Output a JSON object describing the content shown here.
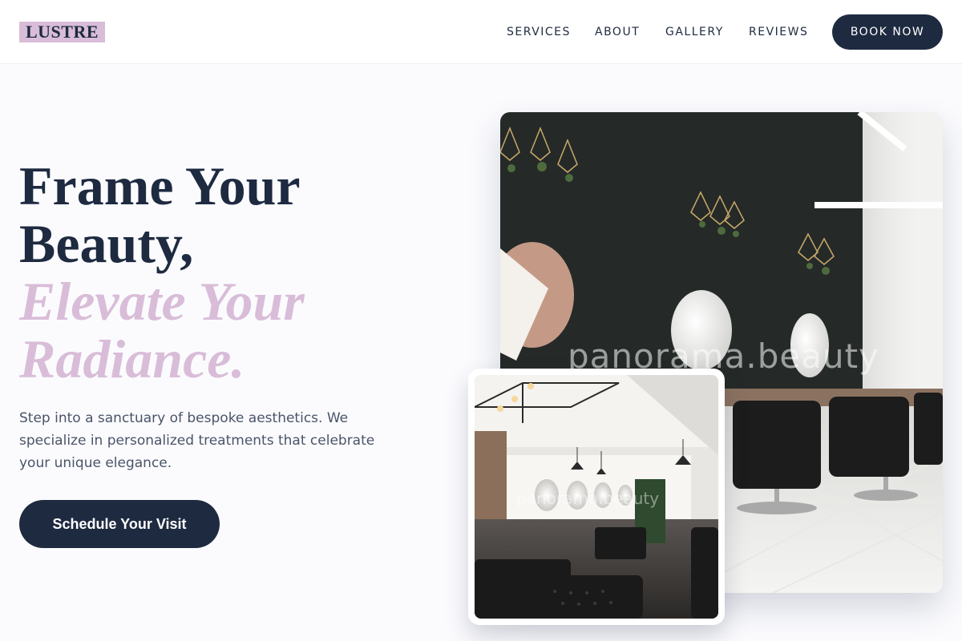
{
  "brand": {
    "logo": "LUSTRE",
    "accent_color": "#d9bdd8",
    "primary_color": "#1e2a40"
  },
  "nav": {
    "items": [
      {
        "label": "SERVICES"
      },
      {
        "label": "ABOUT"
      },
      {
        "label": "GALLERY"
      },
      {
        "label": "REVIEWS"
      }
    ],
    "book_label": "BOOK NOW"
  },
  "hero": {
    "headline_line1": "Frame Your",
    "headline_line2": "Beauty,",
    "accent_line1": "Elevate Your",
    "accent_line2": "Radiance.",
    "description": "Step into a sanctuary of bespoke aesthetics. We specialize in personalized treatments that celebrate your unique elegance.",
    "cta_label": "Schedule Your Visit"
  },
  "images": {
    "main_watermark": "panorama.beauty",
    "inset_watermark": "panorama.beauty"
  }
}
